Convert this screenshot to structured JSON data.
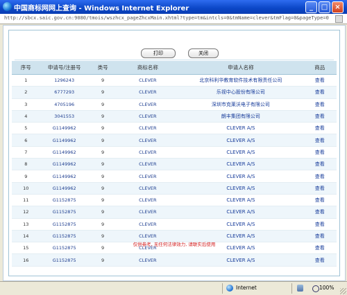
{
  "window": {
    "title": "中国商标网网上查询 - Windows Internet Explorer",
    "url": "http://sbcx.saic.gov.cn:9080/tmois/wszhcx_pageZhcxMain.xhtml?type=tm&intcls=0&tmName=clever&tmFlag=0&pageType=0",
    "controls": {
      "minimize": "_",
      "maximize": "□",
      "close": "×"
    }
  },
  "toolbar": {
    "print_label": "打印",
    "close_label": "关闭"
  },
  "table": {
    "headers": [
      "序号",
      "申请号/注册号",
      "类号",
      "商标名称",
      "申请人名称",
      "商品"
    ],
    "rows": [
      {
        "no": "1",
        "reg": "1296243",
        "cls": "9",
        "mark": "CLEVER",
        "applicant": "北京科利华教育软件技术有限责任公司",
        "action": "查看"
      },
      {
        "no": "2",
        "reg": "6777293",
        "cls": "9",
        "mark": "CLEVER",
        "applicant": "乐视中心股份有限公司",
        "action": "查看"
      },
      {
        "no": "3",
        "reg": "4705196",
        "cls": "9",
        "mark": "CLEVER",
        "applicant": "深圳市克莱沃电子有限公司",
        "action": "查看"
      },
      {
        "no": "4",
        "reg": "3041553",
        "cls": "9",
        "mark": "CLEVER",
        "applicant": "朗丰集团有限公司",
        "action": "查看"
      },
      {
        "no": "5",
        "reg": "G1149962",
        "cls": "9",
        "mark": "CLEVER",
        "applicant": "CLEVER A/S",
        "action": "查看"
      },
      {
        "no": "6",
        "reg": "G1149962",
        "cls": "9",
        "mark": "CLEVER",
        "applicant": "CLEVER A/S",
        "action": "查看"
      },
      {
        "no": "7",
        "reg": "G1149962",
        "cls": "9",
        "mark": "CLEVER",
        "applicant": "CLEVER A/S",
        "action": "查看"
      },
      {
        "no": "8",
        "reg": "G1149962",
        "cls": "9",
        "mark": "CLEVER",
        "applicant": "CLEVER A/S",
        "action": "查看"
      },
      {
        "no": "9",
        "reg": "G1149962",
        "cls": "9",
        "mark": "CLEVER",
        "applicant": "CLEVER A/S",
        "action": "查看"
      },
      {
        "no": "10",
        "reg": "G1149962",
        "cls": "9",
        "mark": "CLEVER",
        "applicant": "CLEVER A/S",
        "action": "查看"
      },
      {
        "no": "11",
        "reg": "G1152875",
        "cls": "9",
        "mark": "CLEVER",
        "applicant": "CLEVER A/S",
        "action": "查看"
      },
      {
        "no": "12",
        "reg": "G1152875",
        "cls": "9",
        "mark": "CLEVER",
        "applicant": "CLEVER A/S",
        "action": "查看"
      },
      {
        "no": "13",
        "reg": "G1152875",
        "cls": "9",
        "mark": "CLEVER",
        "applicant": "CLEVER A/S",
        "action": "查看"
      },
      {
        "no": "14",
        "reg": "G1152875",
        "cls": "9",
        "mark": "CLEVER",
        "applicant": "CLEVER A/S",
        "action": "查看"
      },
      {
        "no": "15",
        "reg": "G1152875",
        "cls": "9",
        "mark": "CLEVER",
        "applicant": "CLEVER A/S",
        "action": "查看"
      },
      {
        "no": "16",
        "reg": "G1152875",
        "cls": "9",
        "mark": "CLEVER",
        "applicant": "CLEVER A/S",
        "action": "查看"
      }
    ]
  },
  "notice": "仅供参考, 无任何法律效力, 请联实后使用",
  "statusbar": {
    "zone": "Internet",
    "zoom": "100%"
  },
  "colors": {
    "titlebar": "#0b46c6",
    "header_bg": "#cfe3ee",
    "link": "#163b9a",
    "notice": "#d42020"
  },
  "icons": [
    "ie-globe-icon",
    "security-icon",
    "zoom-icon"
  ]
}
